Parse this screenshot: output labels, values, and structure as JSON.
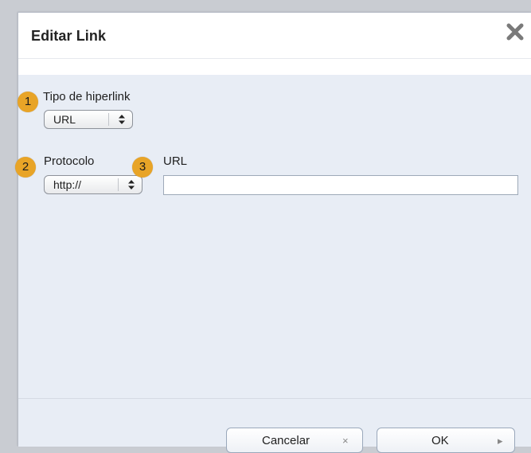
{
  "dialog": {
    "title": "Editar Link",
    "close_icon": "close-icon"
  },
  "fields": {
    "link_type": {
      "label": "Tipo de hiperlink",
      "value": "URL",
      "badge": "1"
    },
    "protocol": {
      "label": "Protocolo",
      "value": "http://",
      "badge": "2"
    },
    "url": {
      "label": "URL",
      "value": "",
      "badge": "3"
    }
  },
  "footer": {
    "cancel_label": "Cancelar",
    "cancel_icon": "×",
    "ok_label": "OK",
    "ok_icon": "▸"
  },
  "colors": {
    "badge": "#e8a427",
    "panel": "#e8edf5",
    "backdrop": "#c9ccd2"
  }
}
